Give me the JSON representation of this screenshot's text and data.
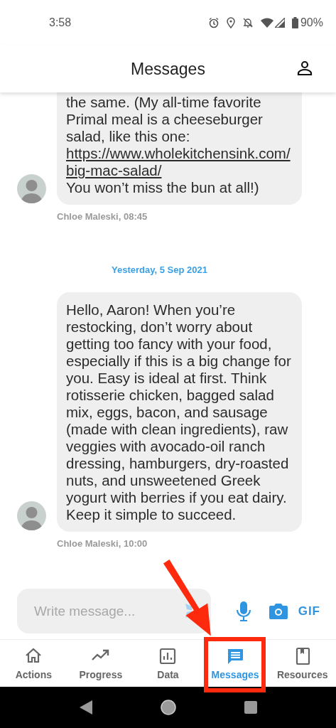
{
  "status_bar": {
    "time": "3:58",
    "battery": "90%"
  },
  "header": {
    "title": "Messages"
  },
  "feed": [
    {
      "kind": "message",
      "blocks": [
        {
          "kind": "text",
          "text": "the same. (My all-time favorite Primal meal is a cheeseburger salad, like this one:"
        },
        {
          "kind": "link",
          "text": "https://www.wholekitchensink.com/big-mac-salad/"
        },
        {
          "kind": "text",
          "text": "You won’t miss the bun at all!)"
        }
      ],
      "sender": "Chloe Maleski, 08:45"
    },
    {
      "kind": "date",
      "text": "Yesterday, 5 Sep 2021"
    },
    {
      "kind": "message",
      "blocks": [
        {
          "kind": "text",
          "text": "Hello, Aaron! When you’re restocking, don’t worry about getting too fancy with your food, especially if this is a big change for you. Easy is ideal at first. Think rotisserie chicken, bagged salad mix, eggs, bacon, and sausage (made with clean ingredients), raw veggies with avocado-oil ranch dressing, hamburgers, dry-roasted nuts, and unsweetened Greek yogurt with berries if you eat dairy. Keep it simple to succeed."
        }
      ],
      "sender": "Chloe Maleski, 10:00"
    }
  ],
  "composer": {
    "placeholder": "Write message...",
    "gif": "GIF"
  },
  "tabs": [
    {
      "label": "Actions",
      "selected": false
    },
    {
      "label": "Progress",
      "selected": false
    },
    {
      "label": "Data",
      "selected": false
    },
    {
      "label": "Messages",
      "selected": true
    },
    {
      "label": "Resources",
      "selected": false
    }
  ]
}
